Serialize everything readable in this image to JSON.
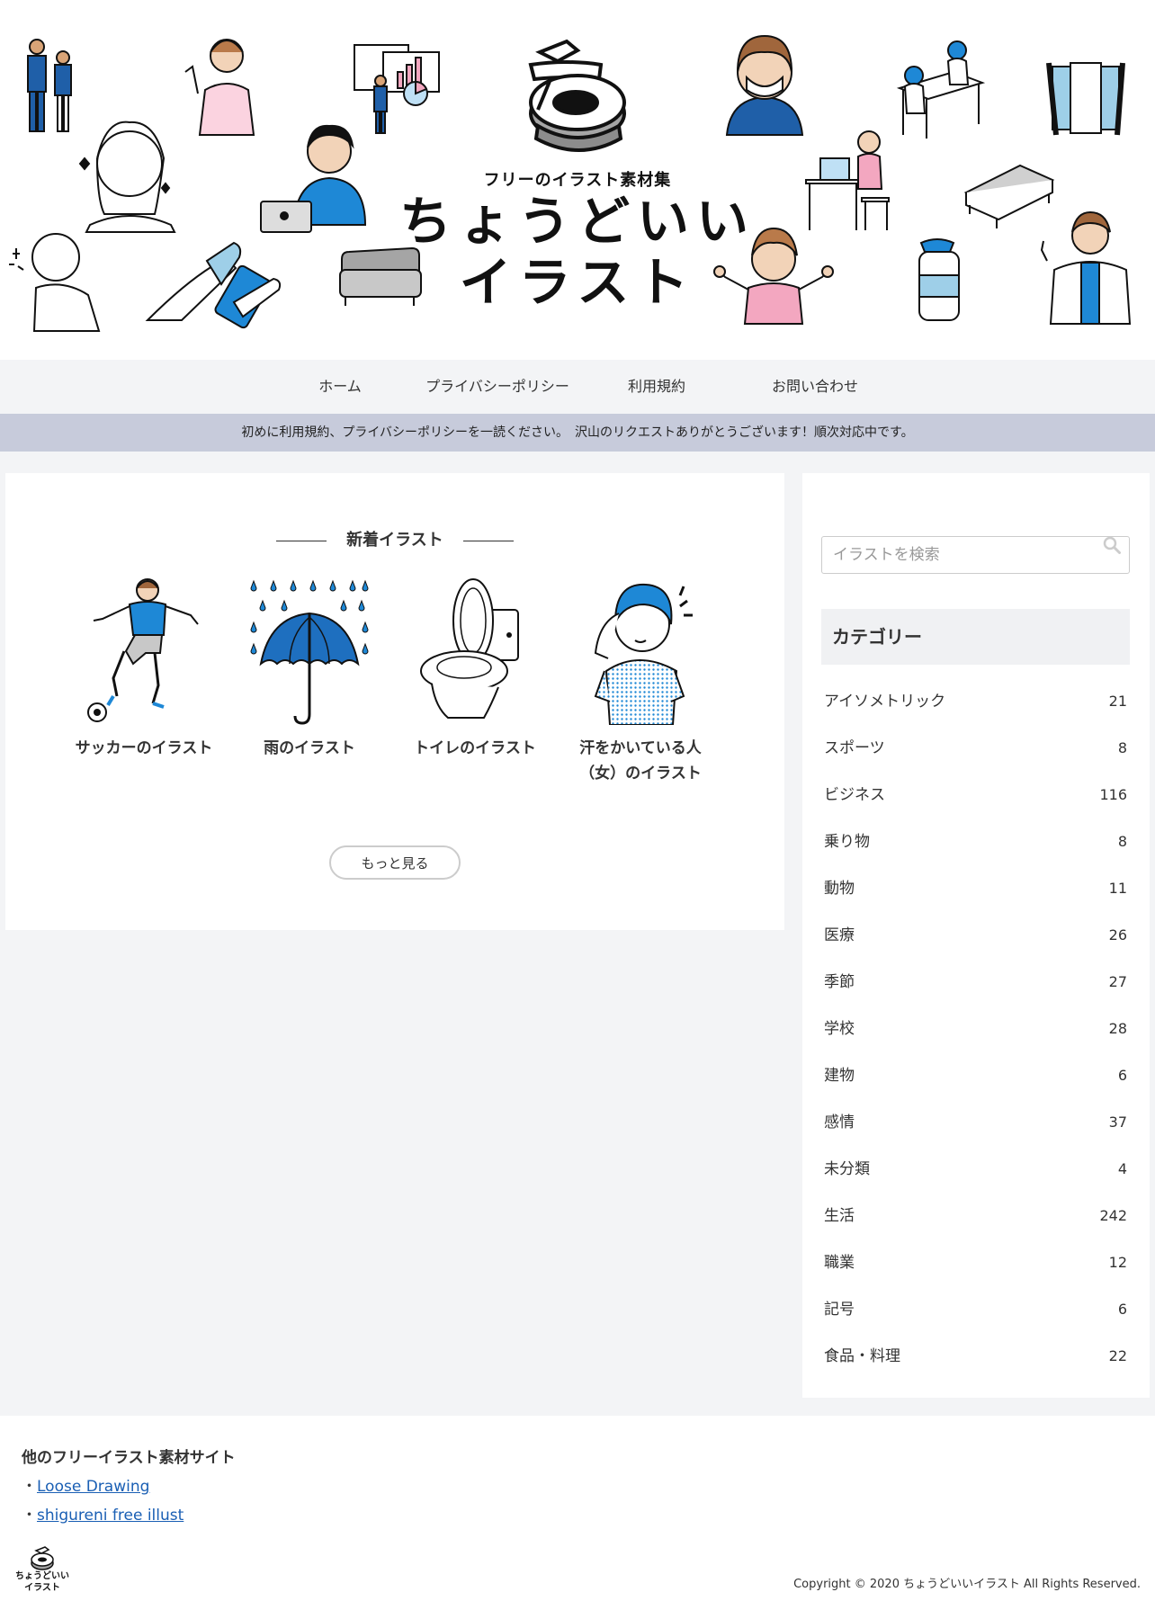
{
  "header": {
    "subtitle": "フリーのイラスト素材集",
    "title_line1": "ちょうどいい",
    "title_line2": "イラスト"
  },
  "nav": {
    "items": [
      {
        "label": "ホーム"
      },
      {
        "label": "プライバシーポリシー"
      },
      {
        "label": "利用規約"
      },
      {
        "label": "お問い合わせ"
      }
    ]
  },
  "notice": {
    "text": "初めに利用規約、プライバシーポリシーを一読ください。　沢山のリクエストありがとうございます！順次対応中です。"
  },
  "main": {
    "heading": "新着イラスト",
    "cards": [
      {
        "title": "サッカーのイラスト",
        "icon": "soccer-player-illustration"
      },
      {
        "title": "雨のイラスト",
        "icon": "umbrella-rain-illustration"
      },
      {
        "title": "トイレのイラスト",
        "icon": "toilet-illustration"
      },
      {
        "title": "汗をかいている人\n（女）のイラスト",
        "icon": "sweating-woman-illustration"
      }
    ],
    "more_label": "もっと見る"
  },
  "sidebar": {
    "search_placeholder": "イラストを検索",
    "category_heading": "カテゴリー",
    "categories": [
      {
        "name": "アイソメトリック",
        "count": "21"
      },
      {
        "name": "スポーツ",
        "count": "8"
      },
      {
        "name": "ビジネス",
        "count": "116"
      },
      {
        "name": "乗り物",
        "count": "8"
      },
      {
        "name": "動物",
        "count": "11"
      },
      {
        "name": "医療",
        "count": "26"
      },
      {
        "name": "季節",
        "count": "27"
      },
      {
        "name": "学校",
        "count": "28"
      },
      {
        "name": "建物",
        "count": "6"
      },
      {
        "name": "感情",
        "count": "37"
      },
      {
        "name": "未分類",
        "count": "4"
      },
      {
        "name": "生活",
        "count": "242"
      },
      {
        "name": "職業",
        "count": "12"
      },
      {
        "name": "記号",
        "count": "6"
      },
      {
        "name": "食品・料理",
        "count": "22"
      }
    ]
  },
  "footer": {
    "heading": "他のフリーイラスト素材サイト",
    "links": [
      {
        "bullet": "・",
        "label": "Loose Drawing"
      },
      {
        "bullet": "・",
        "label": "shigureni free illust"
      }
    ],
    "logo_line1": "ちょうどいい",
    "logo_line2": "イラスト",
    "copyright": "Copyright © 2020 ちょうどいいイラスト All Rights Reserved."
  },
  "colors": {
    "accent_blue": "#1e88d6",
    "notice_bg": "#c7cbdb",
    "page_bg": "#f3f4f6",
    "link": "#1a5fb4"
  }
}
